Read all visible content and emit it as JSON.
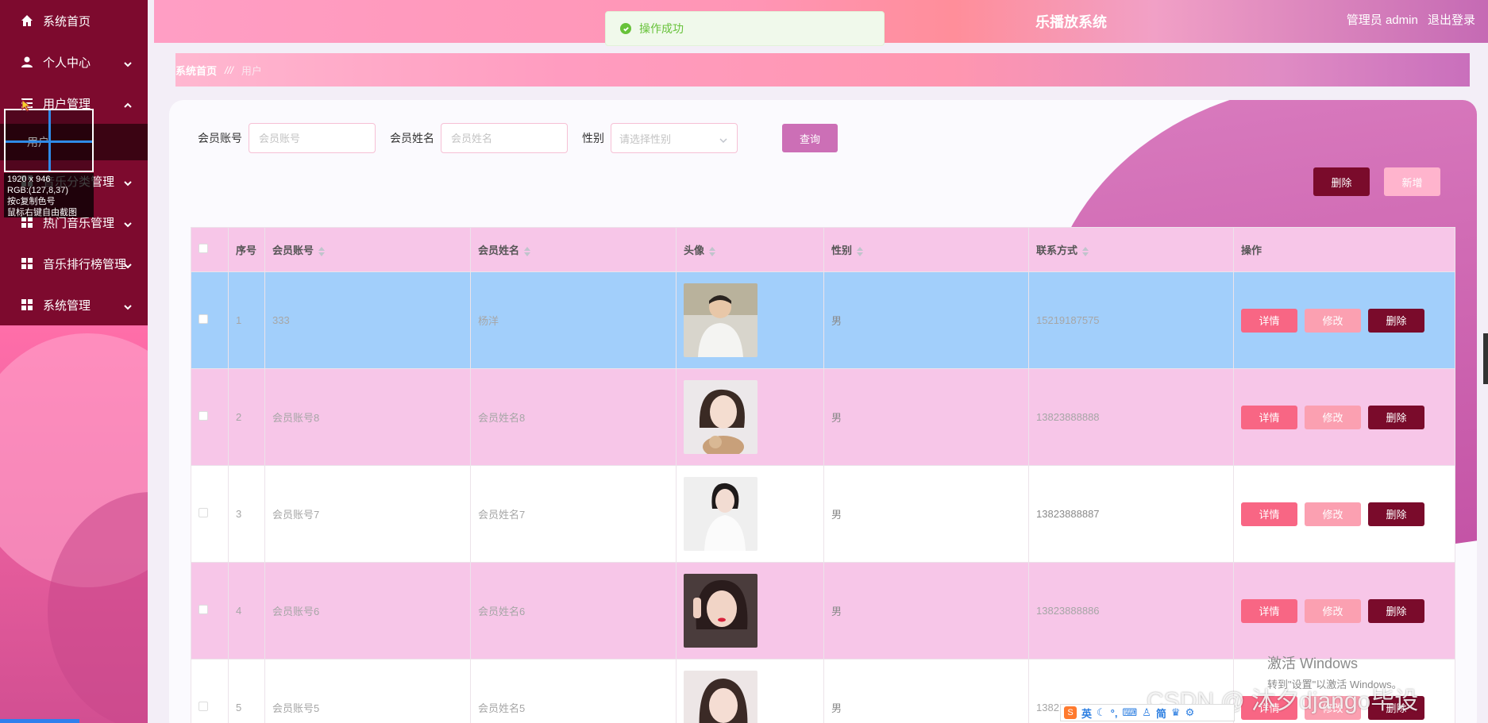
{
  "sidebar": {
    "items": [
      {
        "label": "系统首页",
        "icon": "home-icon",
        "has_chevron": false
      },
      {
        "label": "个人中心",
        "icon": "user-icon",
        "has_chevron": true
      },
      {
        "label": "用户管理",
        "icon": "list-icon",
        "has_chevron": true,
        "expanded": true,
        "children": [
          {
            "label": "用户"
          }
        ]
      },
      {
        "label": "音乐分类管理",
        "icon": "grid-icon",
        "has_chevron": true
      },
      {
        "label": "热门音乐管理",
        "icon": "grid-icon",
        "has_chevron": true
      },
      {
        "label": "音乐排行榜管理",
        "icon": "grid-icon",
        "has_chevron": true
      },
      {
        "label": "系统管理",
        "icon": "grid-icon",
        "has_chevron": true
      }
    ]
  },
  "picker": {
    "size": "1920 x 946",
    "rgb": "RGB:(127,8,37)",
    "hint1": "按c复制色号",
    "hint2": "鼠标右键自由截图"
  },
  "header": {
    "title": "乐播放系统",
    "user_label": "管理员 admin",
    "logout": "退出登录"
  },
  "toast": {
    "text": "操作成功"
  },
  "breadcrumb": {
    "home": "系统首页",
    "sep": "///",
    "current": "用户"
  },
  "search": {
    "account_label": "会员账号",
    "account_placeholder": "会员账号",
    "name_label": "会员姓名",
    "name_placeholder": "会员姓名",
    "gender_label": "性别",
    "gender_placeholder": "请选择性别",
    "query_button": "查询"
  },
  "actions": {
    "delete": "删除",
    "add": "新增"
  },
  "table": {
    "headers": [
      "序号",
      "会员账号",
      "会员姓名",
      "头像",
      "性别",
      "联系方式",
      "操作"
    ],
    "rows": [
      {
        "index": "1",
        "account": "333",
        "name": "杨洋",
        "gender": "男",
        "phone": "15219187575",
        "avatar": "photo-man-white-shirt"
      },
      {
        "index": "2",
        "account": "会员账号8",
        "name": "会员姓名8",
        "gender": "男",
        "phone": "13823888888",
        "avatar": "photo-woman-with-dog"
      },
      {
        "index": "3",
        "account": "会员账号7",
        "name": "会员姓名7",
        "gender": "男",
        "phone": "13823888887",
        "avatar": "photo-woman-white-dress"
      },
      {
        "index": "4",
        "account": "会员账号6",
        "name": "会员姓名6",
        "gender": "男",
        "phone": "13823888886",
        "avatar": "photo-woman-selfie"
      },
      {
        "index": "5",
        "account": "会员账号5",
        "name": "会员姓名5",
        "gender": "男",
        "phone": "1382",
        "avatar": "photo-woman-portrait"
      }
    ],
    "op_buttons": {
      "detail": "详情",
      "edit": "修改",
      "delete": "删除"
    }
  },
  "watermark": {
    "line1": "激活 Windows",
    "line2": "转到\"设置\"以激活 Windows。",
    "csdn": "CSDN @ 沐夕django毕设"
  },
  "ime": {
    "lang": "英",
    "mode": "简"
  },
  "colors": {
    "sidebar_menu": "#7d0a2e",
    "accent": "#cc6fb6",
    "danger": "#7a0b2b",
    "detail": "#f86684",
    "edit": "#fba0b1",
    "row_selected": "#a2cffb",
    "row_pink": "#f7c6e8"
  }
}
